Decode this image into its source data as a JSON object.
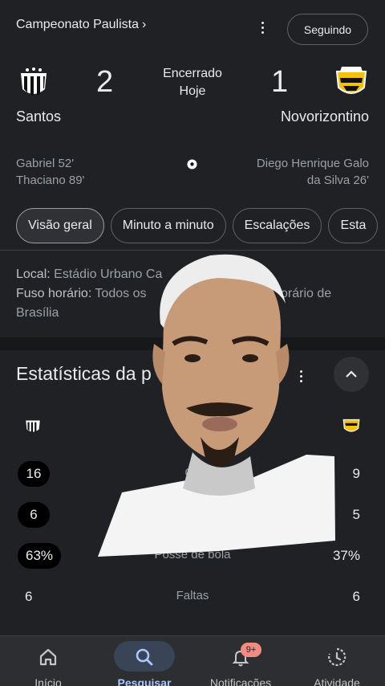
{
  "header": {
    "competition": "Campeonato Paulista",
    "chevron": "›",
    "follow_label": "Seguindo"
  },
  "match": {
    "home": {
      "name": "Santos",
      "score": "2"
    },
    "away": {
      "name": "Novorizontino",
      "score": "1"
    },
    "status_line1": "Encerrado",
    "status_line2": "Hoje"
  },
  "scorers": {
    "home": [
      "Gabriel 52'",
      "Thaciano 89'"
    ],
    "away": [
      "Diego Henrique Galo",
      "da Silva 26'"
    ]
  },
  "tabs": [
    "Visão geral",
    "Minuto a minuto",
    "Escalações",
    "Esta"
  ],
  "info": {
    "local_label": "Local:",
    "local_value": " Estádio Urbano Ca",
    "tz_label": "Fuso horário:",
    "tz_value": " Todos os",
    "tz_tail": "orário de",
    "tz_line2": "Brasília"
  },
  "stats": {
    "title": "Estatísticas da p",
    "rows": [
      {
        "home": "16",
        "name": "Ch",
        "away": "9",
        "pill": true
      },
      {
        "home": "6",
        "name": "",
        "away": "5",
        "pill": true
      },
      {
        "home": "63%",
        "name": "Posse de bola",
        "away": "37%",
        "pill": true
      },
      {
        "home": "6",
        "name": "Faltas",
        "away": "6",
        "pill": false
      }
    ]
  },
  "nav": {
    "items": [
      {
        "label": "Início",
        "icon": "home-icon"
      },
      {
        "label": "Pesquisar",
        "icon": "search-icon"
      },
      {
        "label": "Notificações",
        "icon": "bell-icon"
      },
      {
        "label": "Atividade",
        "icon": "activity-icon"
      }
    ],
    "badge": "9+"
  },
  "colors": {
    "background": "#202124",
    "accent": "#a8c7fa",
    "badge": "#f28b82",
    "away_crest": "#f4c20d"
  }
}
